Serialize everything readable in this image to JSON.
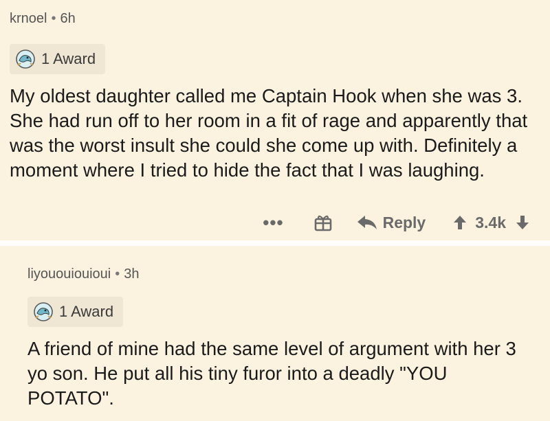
{
  "comments": [
    {
      "author": "krnoel",
      "separator": "•",
      "age": "6h",
      "award_label": "1 Award",
      "body": "My oldest daughter called me Captain Hook when she was 3. She had run off to her room in a fit of rage and apparently that was the worst insult she could she come up with. Definitely a moment where I tried to hide the fact that I was laughing.",
      "actions": {
        "more": "•••",
        "reply_label": "Reply",
        "score": "3.4k"
      }
    },
    {
      "author": "liyououiouioui",
      "separator": "•",
      "age": "3h",
      "award_label": "1 Award",
      "body": "A friend of mine had the same level of argument with her 3 yo son. He put all his tiny furor into a deadly \"YOU POTATO\"."
    }
  ],
  "icons": {
    "award": "award-icon",
    "gift": "gift-icon",
    "reply": "reply-arrow-icon",
    "upvote": "upvote-arrow-icon",
    "downvote": "downvote-arrow-icon"
  },
  "colors": {
    "background": "#fbf3e0",
    "award_chip": "#efe7d4",
    "action_gray": "#6a6a6a"
  }
}
